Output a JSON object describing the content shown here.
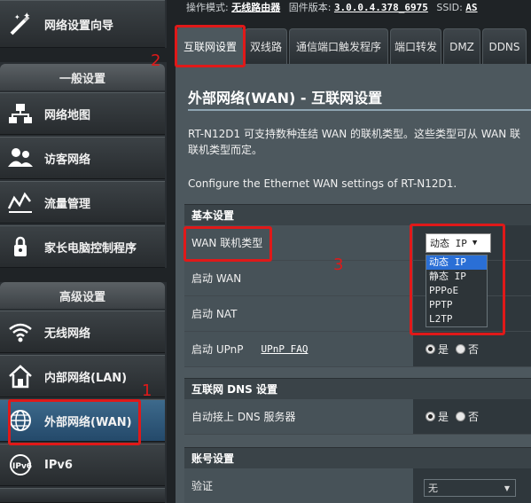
{
  "header": {
    "op_mode_label": "操作模式:",
    "op_mode_value": "无线路由器",
    "firmware_label": "固件版本:",
    "firmware_value": "3.0.0.4.378_6975",
    "ssid_label": "SSID:",
    "ssid_value": "AS"
  },
  "sidebar": {
    "wizard_label": "网络设置向导",
    "general_head": "一般设置",
    "general_items": [
      {
        "label": "网络地图",
        "icon": "network-map-icon"
      },
      {
        "label": "访客网络",
        "icon": "guest-network-icon"
      },
      {
        "label": "流量管理",
        "icon": "traffic-manager-icon"
      },
      {
        "label": "家长电脑控制程序",
        "icon": "parental-control-icon"
      }
    ],
    "advanced_head": "高级设置",
    "advanced_items": [
      {
        "label": "无线网络",
        "icon": "wireless-icon"
      },
      {
        "label": "内部网络(LAN)",
        "icon": "lan-icon"
      },
      {
        "label": "外部网络(WAN)",
        "icon": "wan-globe-icon"
      },
      {
        "label": "IPv6",
        "icon": "ipv6-icon"
      }
    ]
  },
  "tabs": [
    "互联网设置",
    "双线路",
    "通信端口触发程序",
    "端口转发",
    "DMZ",
    "DDNS"
  ],
  "main": {
    "title": "外部网络(WAN) - 互联网设置",
    "desc_line1": "RT-N12D1 可支持数种连结 WAN 的联机类型。这些类型可从 WAN 联",
    "desc_line2": "联机类型而定。",
    "desc_en": "Configure the Ethernet WAN settings of RT-N12D1.",
    "basic_section": "基本设置",
    "wan_type_label": "WAN 联机类型",
    "wan_type_selected": "动态 IP",
    "wan_type_options": [
      "动态 IP",
      "静态 IP",
      "PPPoE",
      "PPTP",
      "L2TP"
    ],
    "enable_wan_label": "启动 WAN",
    "enable_nat_label": "启动 NAT",
    "enable_upnp_label": "启动 UPnP",
    "upnp_faq_link": "UPnP  FAQ",
    "yes": "是",
    "no": "否",
    "dns_section": "互联网 DNS 设置",
    "auto_dns_label": "自动接上 DNS 服务器",
    "account_section": "账号设置",
    "auth_label": "验证",
    "auth_value": "无"
  },
  "annotations": [
    "1",
    "2",
    "3"
  ],
  "colors": {
    "accent_red": "#e01919",
    "selected_blue": "#2a6fd6",
    "content_bg": "#4d585e"
  }
}
